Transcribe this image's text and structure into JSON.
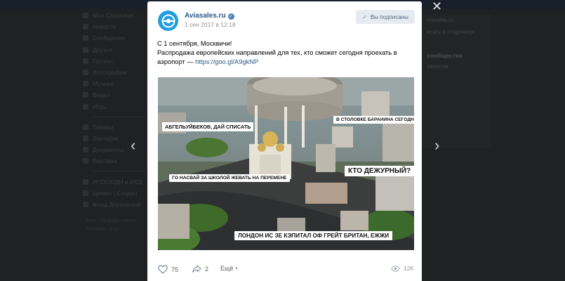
{
  "background": {
    "sidebar_items": [
      "Моя Страница",
      "Новости",
      "Сообщения",
      "Друзья",
      "Группы",
      "Фотографии",
      "Музыка",
      "Видео",
      "Игры"
    ],
    "sidebar_items2": [
      "Товары",
      "Закладки",
      "Документы",
      "Реклама"
    ],
    "sidebar_items3": [
      "ИСОООДИ и ИСД",
      "Цинмы | Создан",
      "Фонд Державный"
    ],
    "footer_links": [
      "Блог · Разработчикам",
      "Реклама · Ещё"
    ],
    "right_panel": {
      "line1": "viasales.ru",
      "line2": "исать в сторонице",
      "header": "сообщества",
      "line3": "записям"
    }
  },
  "post": {
    "author": "Aviasales.ru",
    "date": "1 сен 2017 в 12:18",
    "subscribe_label": "Вы подписаны",
    "text_line1": "С 1 сентября, Москвичи!",
    "text_line2": "Распродажа европейских направлений для тех, кто сможет сегодня проехать в",
    "text_line3": "аэропорт — ",
    "link": "https://goo.gl/A9gkNP",
    "captions": {
      "c1": "АБГЕЛЬУЙБЕКОВ, ДАЙ СПИСАТЬ",
      "c2": "В СТОЛОВКЕ БАРАНИНА СЕГОДНЯ",
      "c3": "ГО НАСВАЙ ЗА ШКОЛОЙ ЖЕВАТЬ НА ПЕРЕМЕНЕ",
      "c4": "КТО ДЕЖУРНЫЙ?",
      "c5": "ЛОНДОН ИС ЗЕ КЭПИТАЛ ОФ ГРЕЙТ БРИТАН, ЕЖЖИ"
    },
    "likes": "75",
    "shares": "2",
    "more_label": "Ещё",
    "views": "12K"
  },
  "colors": {
    "link": "#2a5885",
    "avatar": "#1f9ee0",
    "subscribe_bg": "#e5ebf1"
  },
  "icons": [
    "heart-icon",
    "share-icon",
    "chevron-down-icon",
    "eye-icon",
    "check-icon",
    "close-icon",
    "arrow-left-icon",
    "arrow-right-icon",
    "verified-icon"
  ]
}
